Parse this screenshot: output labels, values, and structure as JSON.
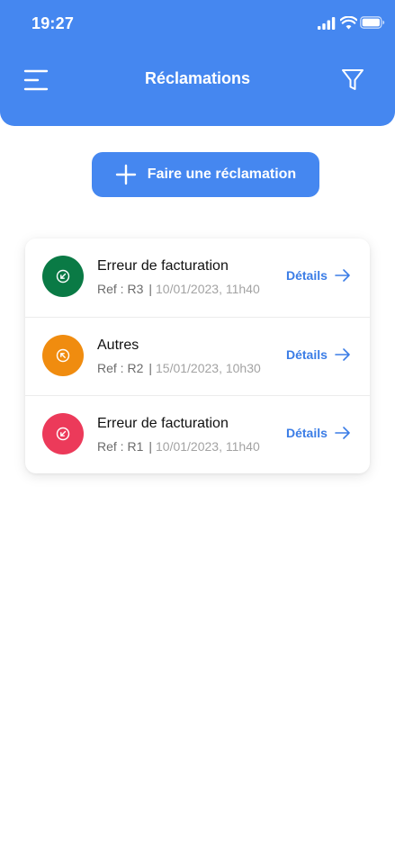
{
  "status_bar": {
    "time": "19:27"
  },
  "header": {
    "title": "Réclamations"
  },
  "create_button": {
    "label": "Faire une réclamation"
  },
  "claims": [
    {
      "title": "Erreur de facturation",
      "ref": "Ref : R3",
      "date": "10/01/2023, 11h40",
      "details_label": "Détails",
      "status_color": "#0a7a45"
    },
    {
      "title": "Autres",
      "ref": "Ref : R2",
      "date": "15/01/2023, 10h30",
      "details_label": "Détails",
      "status_color": "#f08c0f"
    },
    {
      "title": "Erreur de facturation",
      "ref": "Ref : R1",
      "date": "10/01/2023, 11h40",
      "details_label": "Détails",
      "status_color": "#ec3a5a"
    }
  ],
  "colors": {
    "primary": "#4587f0",
    "link": "#3b7de6"
  }
}
